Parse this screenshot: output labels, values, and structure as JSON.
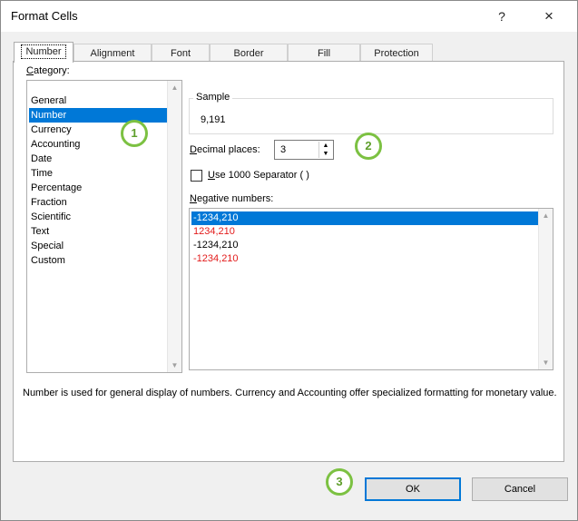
{
  "window": {
    "title": "Format Cells",
    "help_label": "?",
    "close_label": "×"
  },
  "tabs": [
    {
      "label": "Number",
      "active": true
    },
    {
      "label": "Alignment"
    },
    {
      "label": "Font"
    },
    {
      "label": "Border"
    },
    {
      "label": "Fill"
    },
    {
      "label": "Protection"
    }
  ],
  "category": {
    "label_prefix": "",
    "label_underlined": "C",
    "label_rest": "ategory:",
    "items": [
      "General",
      "Number",
      "Currency",
      "Accounting",
      "Date",
      "Time",
      "Percentage",
      "Fraction",
      "Scientific",
      "Text",
      "Special",
      "Custom"
    ],
    "selected": "Number"
  },
  "sample": {
    "title": "Sample",
    "value": "9,191"
  },
  "decimal_places": {
    "label_underlined": "D",
    "label_rest": "ecimal places:",
    "value": "3"
  },
  "separator": {
    "label_underlined": "U",
    "label_rest": "se 1000 Separator ( )",
    "checked": false
  },
  "negative_numbers": {
    "label_underlined": "N",
    "label_rest": "egative numbers:",
    "items": [
      {
        "text": "-1234,210",
        "selected": true
      },
      {
        "text": "1234,210",
        "color": "#e21b1b"
      },
      {
        "text": "-1234,210"
      },
      {
        "text": "-1234,210",
        "color": "#e21b1b"
      }
    ]
  },
  "description": "Number is used for general display of numbers.  Currency and Accounting offer specialized formatting for monetary value.",
  "buttons": {
    "ok": "OK",
    "cancel": "Cancel"
  },
  "markers": [
    "1",
    "2",
    "3"
  ],
  "colors": {
    "selection": "#0078d7",
    "negative_red": "#e21b1b",
    "marker_green": "#7cc142"
  }
}
